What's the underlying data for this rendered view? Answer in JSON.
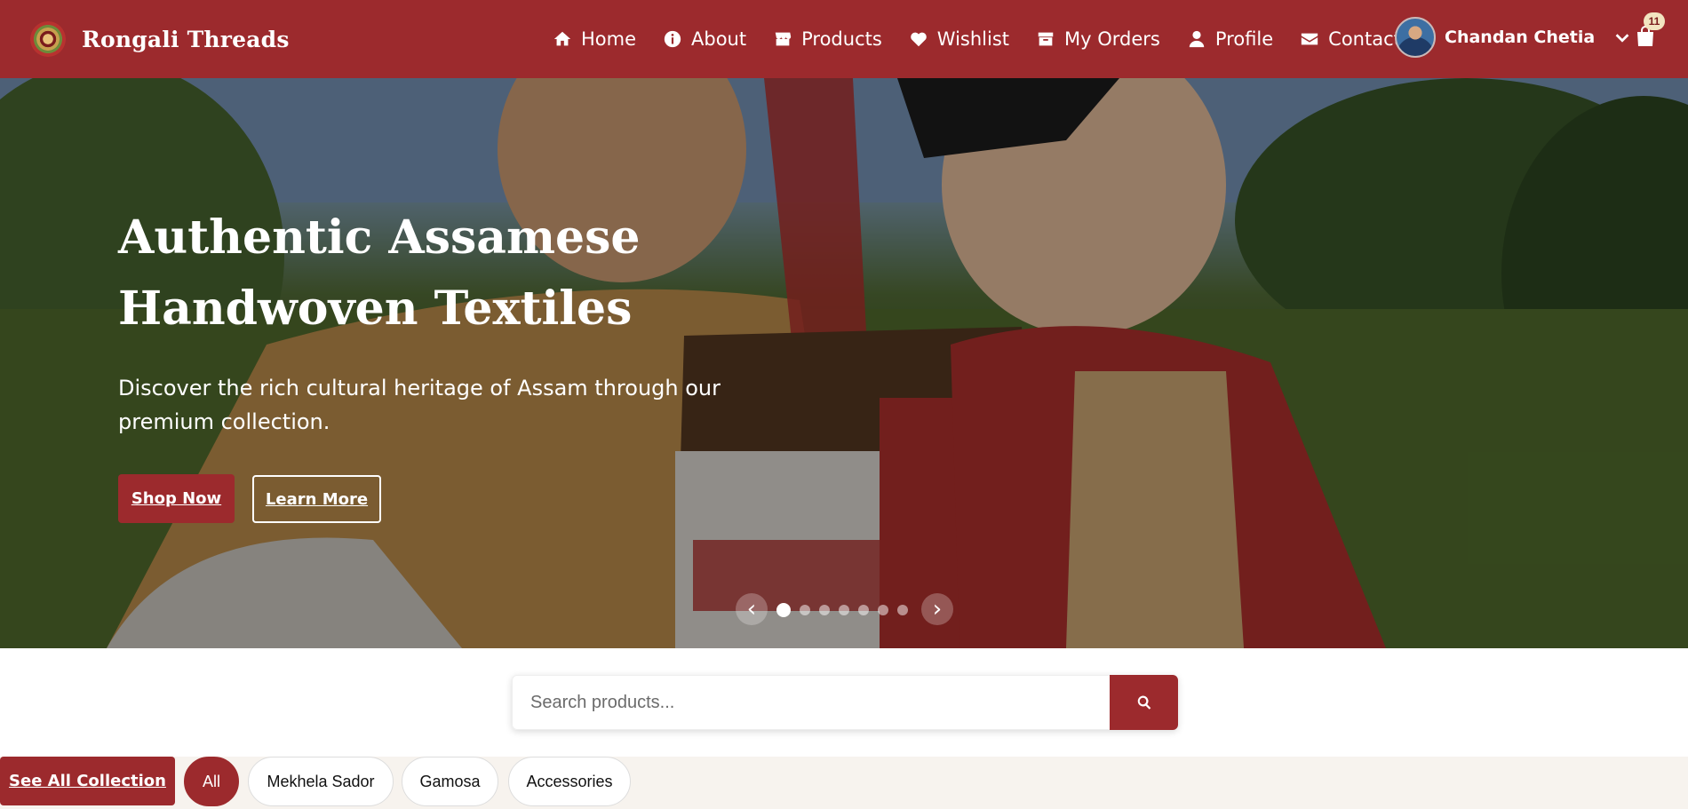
{
  "brand": {
    "name": "Rongali Threads"
  },
  "nav": {
    "items": [
      {
        "label": "Home",
        "icon": "home-icon"
      },
      {
        "label": "About",
        "icon": "info-icon"
      },
      {
        "label": "Products",
        "icon": "store-icon"
      },
      {
        "label": "Wishlist",
        "icon": "heart-icon"
      },
      {
        "label": "My Orders",
        "icon": "box-icon"
      },
      {
        "label": "Profile",
        "icon": "user-icon"
      },
      {
        "label": "Contact",
        "icon": "envelope-icon"
      }
    ],
    "user_name": "Chandan Chetia",
    "cart_count": "11"
  },
  "hero": {
    "title": "Authentic Assamese Handwoven Textiles",
    "subtitle": "Discover the rich cultural heritage of Assam through our premium collection.",
    "shop_label": "Shop Now",
    "learn_label": "Learn More",
    "prev": "‹",
    "next": "›",
    "slide_count": 7,
    "active_slide": 1
  },
  "search": {
    "placeholder": "Search products..."
  },
  "filters": {
    "see_all": "See All Collection",
    "chips": [
      "All",
      "Mekhela Sador",
      "Gamosa",
      "Accessories"
    ],
    "active": "All"
  },
  "colors": {
    "primary": "#9c2a2d",
    "filter_bg": "#f7f3ee",
    "badge": "#f2e4c0"
  }
}
